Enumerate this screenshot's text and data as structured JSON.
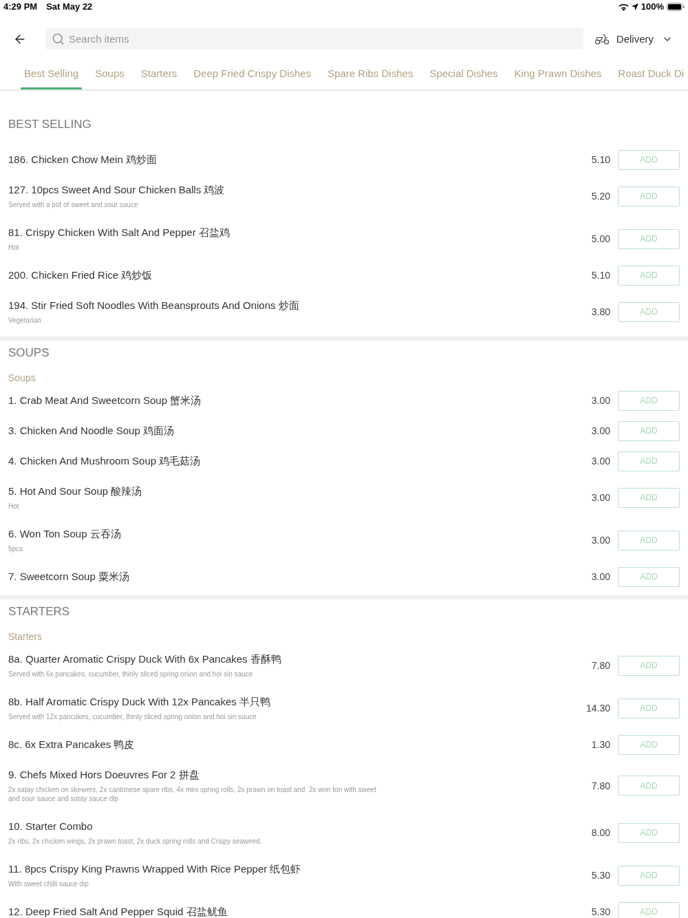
{
  "status_bar": {
    "time": "4:29 PM",
    "date": "Sat May 22",
    "battery": "100%"
  },
  "header": {
    "search": {
      "placeholder": "Search items"
    },
    "delivery": {
      "label": "Delivery"
    }
  },
  "tabs": [
    {
      "label": "Best Selling",
      "selected": true
    },
    {
      "label": "Soups",
      "selected": false
    },
    {
      "label": "Starters",
      "selected": false
    },
    {
      "label": "Deep Fried Crispy Dishes",
      "selected": false
    },
    {
      "label": "Spare Ribs Dishes",
      "selected": false
    },
    {
      "label": "Special Dishes",
      "selected": false
    },
    {
      "label": "King Prawn Dishes",
      "selected": false
    },
    {
      "label": "Roast Duck Di",
      "selected": false
    }
  ],
  "sections": [
    {
      "title": "BEST SELLING",
      "items": [
        {
          "name": "186. Chicken Chow Mein 鸡炒面",
          "price": "5.10",
          "button": "ADD"
        },
        {
          "name": "127. 10pcs Sweet And Sour Chicken Balls 鸡波",
          "description": "Served with a pot of sweet and sour sauce",
          "price": "5.20",
          "button": "ADD"
        },
        {
          "name": "81. Crispy Chicken With Salt And Pepper 召盐鸡",
          "description": "Hot",
          "price": "5.00",
          "button": "ADD"
        },
        {
          "name": "200. Chicken Fried Rice 鸡炒饭",
          "price": "5.10",
          "button": "ADD"
        },
        {
          "name": "194. Stir Fried Soft Noodles With Beansprouts And Onions 炒面",
          "description": "Vegetarian",
          "price": "3.80",
          "button": "ADD"
        }
      ]
    },
    {
      "title": "SOUPS",
      "subtitle": "Soups",
      "items": [
        {
          "name": "1. Crab Meat And Sweetcorn Soup 蟹米汤",
          "price": "3.00",
          "button": "ADD"
        },
        {
          "name": "3. Chicken And Noodle Soup 鸡面汤",
          "price": "3.00",
          "button": "ADD"
        },
        {
          "name": "4. Chicken And Mushroom Soup 鸡毛菇汤",
          "price": "3.00",
          "button": "ADD"
        },
        {
          "name": "5. Hot And Sour Soup 酸辣汤",
          "description": "Hot",
          "price": "3.00",
          "button": "ADD"
        },
        {
          "name": "6. Won Ton Soup 云吞汤",
          "description": "5pcs",
          "price": "3.00",
          "button": "ADD"
        },
        {
          "name": "7. Sweetcorn Soup 粟米汤",
          "price": "3.00",
          "button": "ADD"
        }
      ]
    },
    {
      "title": "STARTERS",
      "subtitle": "Starters",
      "items": [
        {
          "name": "8a. Quarter Aromatic Crispy Duck With 6x Pancakes 香酥鸭",
          "description": "Served with 6x pancakes, cucumber, thinly sliced spring onion and hoi sin sauce",
          "price": "7.80",
          "button": "ADD"
        },
        {
          "name": "8b. Half Aromatic Crispy Duck With 12x Pancakes 半只鸭",
          "description": "Served with 12x pancakes, cucumber, thinly sliced spring onion and hoi sin sauce",
          "price": "14.30",
          "button": "ADD"
        },
        {
          "name": "8c. 6x Extra Pancakes 鸭皮",
          "price": "1.30",
          "button": "ADD"
        },
        {
          "name": "9. Chefs Mixed Hors Doeuvres For 2 拼盘",
          "description": "2x satay chicken on skewers, 2x cantonese spare ribs, 4x mini spring rolls, 2x prawn on toast and  2x won ton with sweet and sour sauce and satay sauce dip",
          "price": "7.80",
          "button": "ADD"
        },
        {
          "name": "10. Starter Combo",
          "description": "2x ribs, 2x chicken wings, 2x prawn toast, 2x duck spring rolls and Crispy seaweed.",
          "price": "8.00",
          "button": "ADD"
        },
        {
          "name": "11. 8pcs Crispy King Prawns Wrapped With Rice Pepper 纸包虾",
          "description": "With sweet chilli sauce dip",
          "price": "5.30",
          "button": "ADD"
        },
        {
          "name": "12. Deep Fried Salt And Pepper Squid 召盐鱿鱼",
          "price": "5.30",
          "button": "ADD"
        }
      ]
    }
  ]
}
